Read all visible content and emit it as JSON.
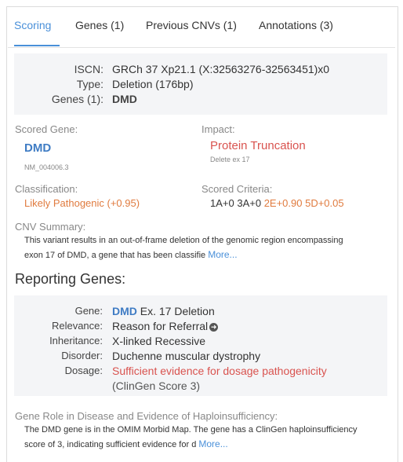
{
  "tabs": [
    {
      "label": "Scoring"
    },
    {
      "label": "Genes (1)"
    },
    {
      "label": "Previous CNVs (1)"
    },
    {
      "label": "Annotations (3)"
    }
  ],
  "summary": {
    "iscn_label": "ISCN:",
    "iscn_value": "GRCh 37 Xp21.1 (X:32563276-32563451)x0",
    "type_label": "Type:",
    "type_value": "Deletion (176bp)",
    "genes_label": "Genes (1):",
    "genes_value": "DMD"
  },
  "scored_gene": {
    "label": "Scored Gene:",
    "gene": "DMD",
    "transcript": "NM_004006.3"
  },
  "impact": {
    "label": "Impact:",
    "value": "Protein Truncation",
    "detail": "Delete ex 17"
  },
  "classification": {
    "label": "Classification:",
    "value": "Likely Pathogenic (+0.95)"
  },
  "scored_criteria": {
    "label": "Scored Criteria:",
    "neutral": "1A+0 3A+0",
    "positive": "2E+0.90 5D+0.05"
  },
  "cnv_summary": {
    "label": "CNV Summary:",
    "line1": "This variant results in an out-of-frame deletion of the genomic region encompassing",
    "line2": "exon 17 of DMD, a gene that has been classifie",
    "more": "More..."
  },
  "reporting_genes": {
    "heading": "Reporting Genes:",
    "gene_label": "Gene:",
    "gene_symbol": "DMD",
    "gene_rest": "Ex. 17 Deletion",
    "relevance_label": "Relevance:",
    "relevance_value": "Reason for Referral",
    "inheritance_label": "Inheritance:",
    "inheritance_value": "X-linked Recessive",
    "disorder_label": "Disorder:",
    "disorder_value": "Duchenne muscular dystrophy",
    "dosage_label": "Dosage:",
    "dosage_value": "Sufficient evidence for dosage pathogenicity",
    "dosage_score": "(ClinGen Score 3)"
  },
  "gene_role": {
    "label": "Gene Role in Disease and Evidence of Haploinsufficiency:",
    "line1": "The DMD gene is in the OMIM Morbid Map. The gene has a ClinGen haploinsufficiency",
    "line2": "score of 3, indicating sufficient evidence for d",
    "more": "More..."
  },
  "colors": {
    "accent": "#4a90d9",
    "orange": "#e07b3f",
    "red": "#d9534f",
    "gene_blue": "#3f7cc4"
  },
  "icons": [
    "arrow-right-circle-icon"
  ]
}
